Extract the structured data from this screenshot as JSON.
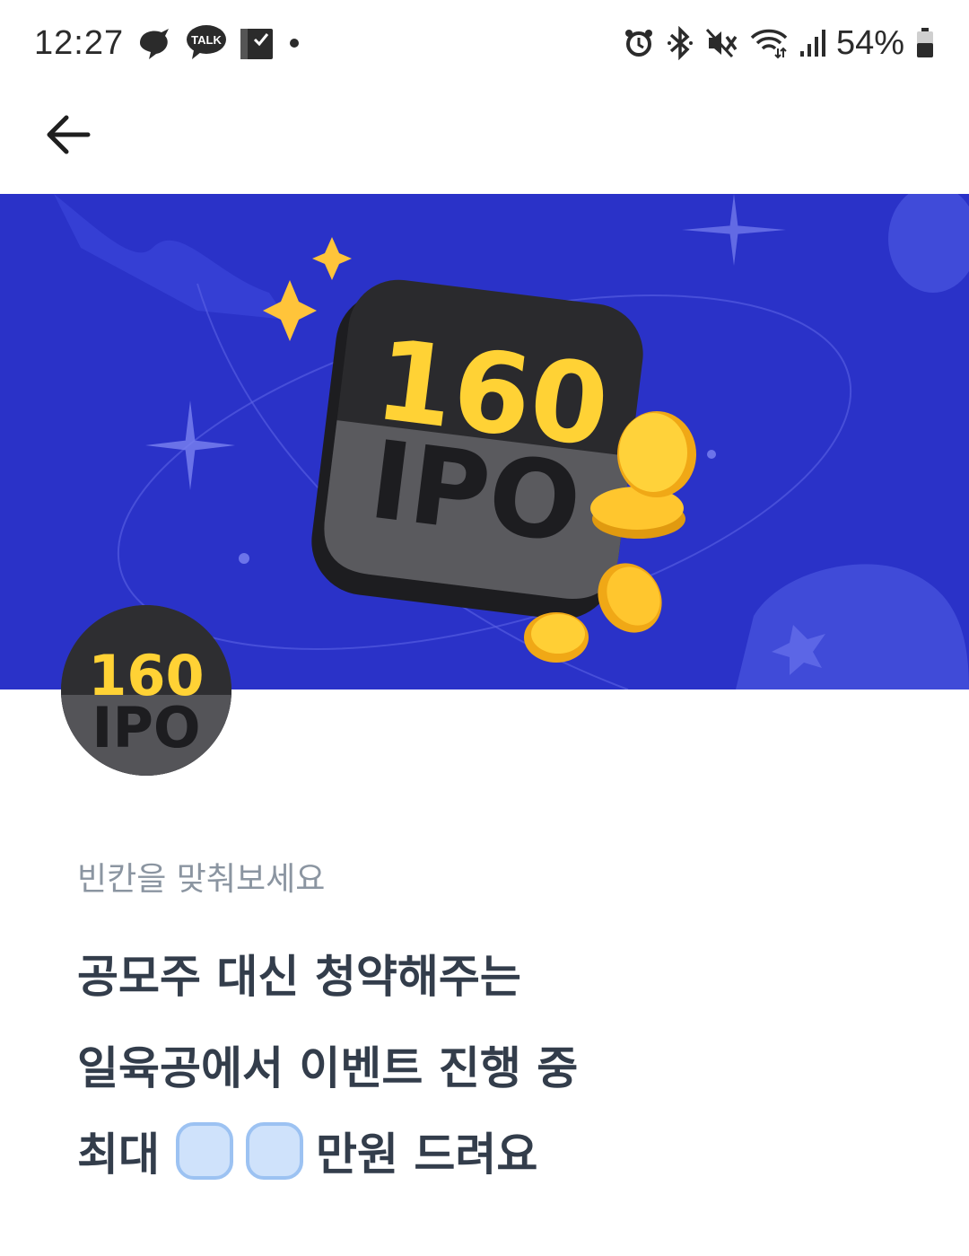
{
  "status_bar": {
    "time": "12:27",
    "battery_percent": "54%",
    "left_icons": [
      "kakaostory-icon",
      "kakaotalk-icon",
      "calendar-check-icon",
      "dot-icon"
    ],
    "right_icons": [
      "alarm-icon",
      "bluetooth-icon",
      "mute-icon",
      "wifi-icon",
      "signal-icon",
      "battery-icon"
    ],
    "kakaotalk_label": "TALK"
  },
  "app_bar": {
    "back_icon": "arrow-left-icon"
  },
  "banner": {
    "background": "#2a32c8",
    "logo_number": "160",
    "logo_text": "IPO",
    "accent": "#ffd235"
  },
  "avatar": {
    "number": "160",
    "text": "IPO"
  },
  "quiz": {
    "hint": "빈칸을 맞춰보세요",
    "line1": "공모주 대신 청약해주는",
    "line2": "일육공에서 이벤트 진행 중",
    "line3_prefix": "최대",
    "line3_suffix": "만원 드려요",
    "blank_count": 2,
    "blank_fill": "#cfe2fb",
    "blank_border": "#9cc2f2"
  }
}
